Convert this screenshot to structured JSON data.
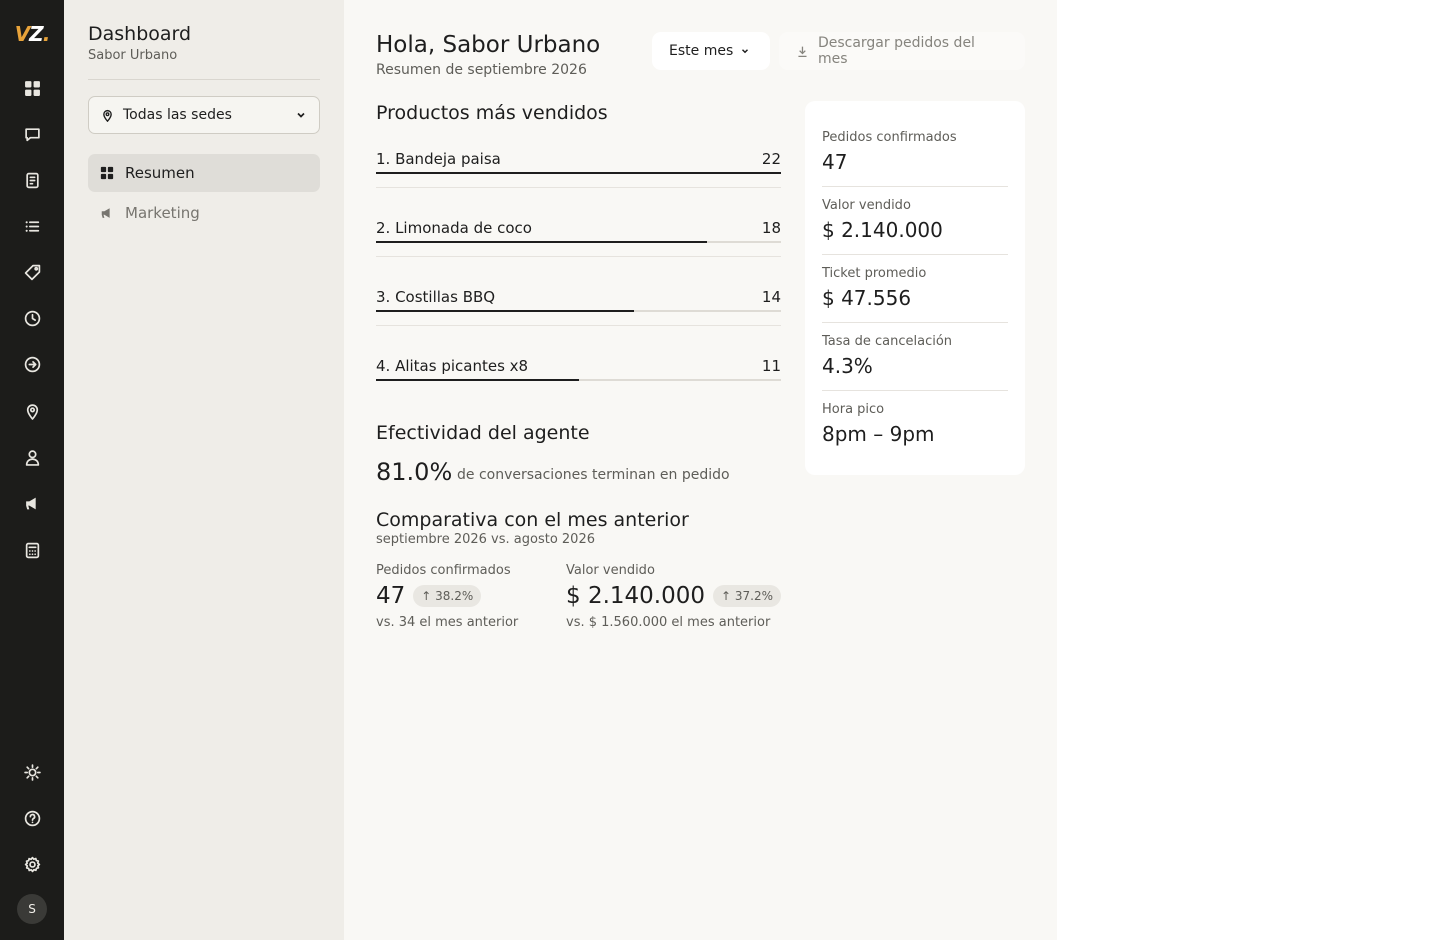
{
  "rail": {
    "logo": "VZ",
    "nav_icons": [
      "grid-icon",
      "chat-icon",
      "receipt-icon",
      "list-icon",
      "tag-icon",
      "clock-icon",
      "arrow-circle-icon",
      "location-pin-icon",
      "user-icon",
      "megaphone-icon",
      "calculator-icon"
    ],
    "bottom_icons": [
      "sun-icon",
      "help-icon",
      "gear-icon"
    ],
    "avatar_initial": "S"
  },
  "sidebar": {
    "title": "Dashboard",
    "subtitle": "Sabor Urbano",
    "location_select": "Todas las sedes",
    "items": [
      {
        "label": "Resumen",
        "icon": "grid-icon",
        "active": true
      },
      {
        "label": "Marketing",
        "icon": "megaphone-icon",
        "active": false
      }
    ]
  },
  "header": {
    "greeting": "Hola, Sabor Urbano",
    "subtitle": "Resumen de septiembre 2026",
    "period_button": "Este mes",
    "download_button": "Descargar pedidos del mes"
  },
  "top_products": {
    "title": "Productos más vendidos",
    "items": [
      {
        "name": "1. Bandeja paisa",
        "count": "22",
        "share": 1.0
      },
      {
        "name": "2. Limonada de coco",
        "count": "18",
        "share": 0.818
      },
      {
        "name": "3. Costillas BBQ",
        "count": "14",
        "share": 0.636
      },
      {
        "name": "4. Alitas picantes x8",
        "count": "11",
        "share": 0.5
      }
    ]
  },
  "agent": {
    "title": "Efectividad del agente",
    "value": "81.0%",
    "text": "de conversaciones terminan en pedido"
  },
  "comparison": {
    "title": "Comparativa con el mes anterior",
    "subtitle": "septiembre 2026 vs. agosto 2026",
    "metrics": [
      {
        "label": "Pedidos confirmados",
        "value": "47",
        "change": "↑ 38.2%",
        "previous": "vs. 34 el mes anterior"
      },
      {
        "label": "Valor vendido",
        "value": "$ 2.140.000",
        "change": "↑ 37.2%",
        "previous": "vs. $ 1.560.000 el mes anterior"
      }
    ]
  },
  "kpis": [
    {
      "label": "Pedidos confirmados",
      "value": "47"
    },
    {
      "label": "Valor vendido",
      "value": "$ 2.140.000"
    },
    {
      "label": "Ticket promedio",
      "value": "$ 47.556"
    },
    {
      "label": "Tasa de cancelación",
      "value": "4.3%"
    },
    {
      "label": "Hora pico",
      "value": "8pm – 9pm"
    }
  ],
  "colors": {
    "rail_bg": "#1c1c1a",
    "sidebar_bg": "#efede8",
    "main_bg": "#f9f8f5",
    "logo_accent": "#e8a33a",
    "bar_fill": "#1e1e1e"
  }
}
